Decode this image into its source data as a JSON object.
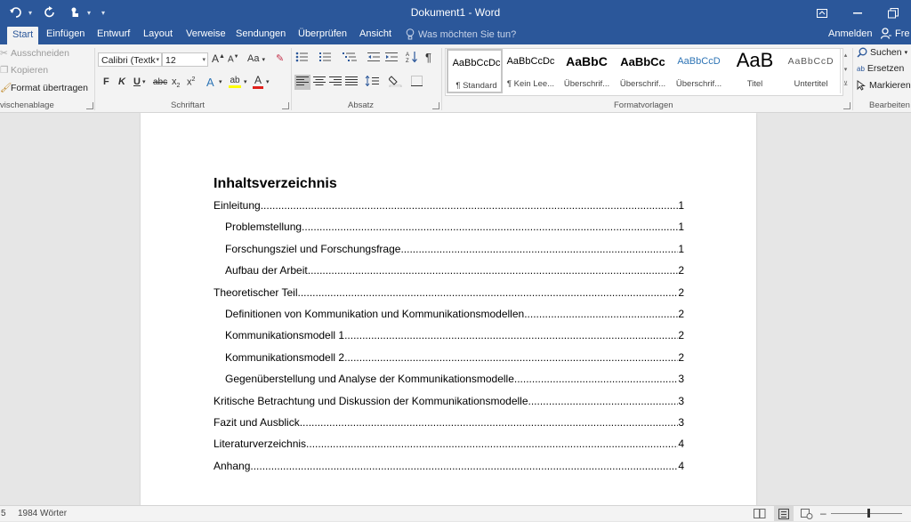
{
  "window": {
    "title": "Dokument1 - Word"
  },
  "tabs": [
    {
      "label": "Start",
      "active": true
    },
    {
      "label": "Einfügen"
    },
    {
      "label": "Entwurf"
    },
    {
      "label": "Layout"
    },
    {
      "label": "Verweise"
    },
    {
      "label": "Sendungen"
    },
    {
      "label": "Überprüfen"
    },
    {
      "label": "Ansicht"
    }
  ],
  "tell_me": "Was möchten Sie tun?",
  "account": {
    "signin": "Anmelden",
    "share": "Fre"
  },
  "ribbon": {
    "clipboard": {
      "cut": "Ausschneiden",
      "copy": "Kopieren",
      "format_painter": "Format übertragen",
      "label": "vischenablage"
    },
    "font": {
      "font_name": "Calibri (Textk",
      "font_size": "12",
      "bold": "F",
      "italic": "K",
      "underline": "U",
      "strike": "abc",
      "subscript": "x",
      "superscript": "x",
      "grow": "A",
      "shrink": "A",
      "case": "Aa",
      "label": "Schriftart"
    },
    "paragraph": {
      "label": "Absatz"
    },
    "styles": {
      "label": "Formatvorlagen",
      "items": [
        {
          "preview": "AaBbCcDc",
          "name": "¶ Standard"
        },
        {
          "preview": "AaBbCcDc",
          "name": "¶ Kein Lee..."
        },
        {
          "preview": "AaBbC",
          "name": "Überschrif..."
        },
        {
          "preview": "AaBbCc",
          "name": "Überschrif..."
        },
        {
          "preview": "AaBbCcD",
          "name": "Überschrif..."
        },
        {
          "preview": "AaB",
          "name": "Titel"
        },
        {
          "preview": "AaBbCcD",
          "name": "Untertitel"
        }
      ]
    },
    "editing": {
      "find": "Suchen",
      "replace": "Ersetzen",
      "select": "Markieren",
      "label": "Bearbeiten"
    }
  },
  "document": {
    "toc_title": "Inhaltsverzeichnis",
    "entries": [
      {
        "text": "Einleitung",
        "page": "1",
        "level": 1
      },
      {
        "text": "Problemstellung",
        "page": "1",
        "level": 2
      },
      {
        "text": "Forschungsziel und Forschungsfrage",
        "page": "1",
        "level": 2
      },
      {
        "text": "Aufbau der Arbeit",
        "page": "2",
        "level": 2
      },
      {
        "text": "Theoretischer Teil",
        "page": "2",
        "level": 1
      },
      {
        "text": "Definitionen von Kommunikation und Kommunikationsmodellen",
        "page": "2",
        "level": 2
      },
      {
        "text": "Kommunikationsmodell 1",
        "page": "2",
        "level": 2
      },
      {
        "text": "Kommunikationsmodell 2",
        "page": "2",
        "level": 2
      },
      {
        "text": "Gegenüberstellung und Analyse der Kommunikationsmodelle",
        "page": "3",
        "level": 2
      },
      {
        "text": "Kritische Betrachtung und Diskussion der Kommunikationsmodelle",
        "page": "3",
        "level": 1
      },
      {
        "text": "Fazit und Ausblick",
        "page": "3",
        "level": 1
      },
      {
        "text": "Literaturverzeichnis",
        "page": "4",
        "level": 1
      },
      {
        "text": "Anhang",
        "page": "4",
        "level": 1
      }
    ]
  },
  "status": {
    "page_fragment": "5",
    "word_count": "1984 Wörter"
  },
  "colors": {
    "accent": "#2b579a",
    "ribbon": "#f3f3f3",
    "canvas": "#e6e6e6"
  }
}
